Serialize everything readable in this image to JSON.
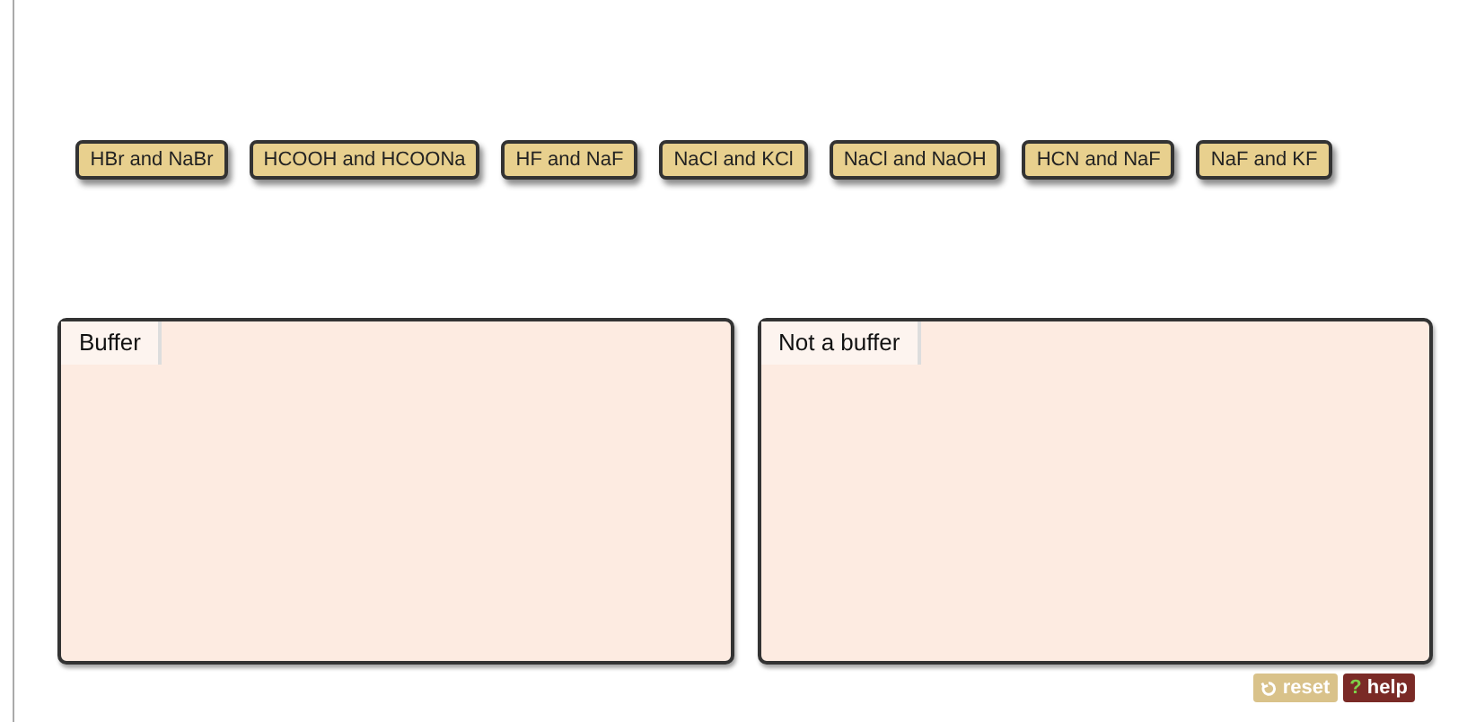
{
  "items": [
    {
      "label": "HBr and NaBr"
    },
    {
      "label": "HCOOH and HCOONa"
    },
    {
      "label": "HF and NaF"
    },
    {
      "label": "NaCl and KCl"
    },
    {
      "label": "NaCl and NaOH"
    },
    {
      "label": "HCN and NaF"
    },
    {
      "label": "NaF and KF"
    }
  ],
  "bins": [
    {
      "label": "Buffer"
    },
    {
      "label": "Not a buffer"
    }
  ],
  "reset": {
    "label": "reset",
    "disabled": true
  },
  "help": {
    "label": "help",
    "icon": "?"
  }
}
